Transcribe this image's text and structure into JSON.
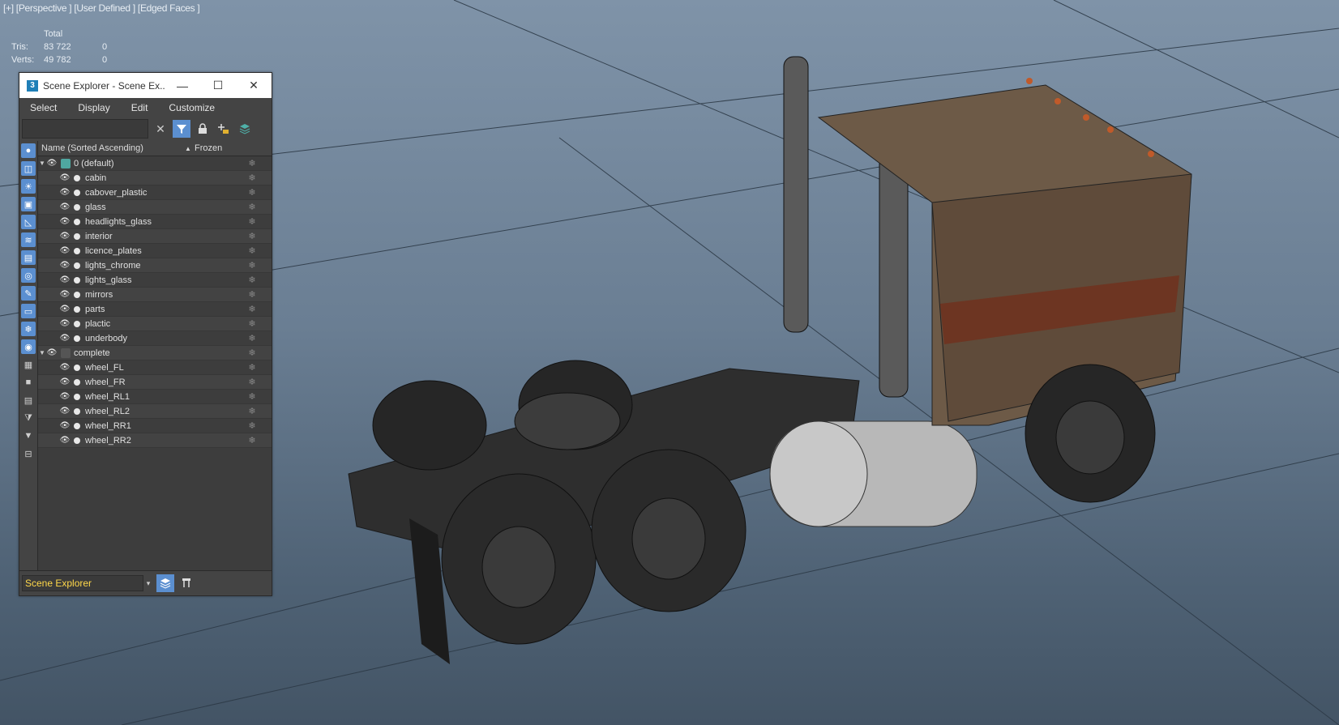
{
  "viewport": {
    "label": "[+] [Perspective ] [User Defined ] [Edged Faces ]",
    "stats": {
      "header": "Total",
      "rows": [
        {
          "label": "Tris:",
          "total": "83 722",
          "selected": "0"
        },
        {
          "label": "Verts:",
          "total": "49 782",
          "selected": "0"
        }
      ]
    }
  },
  "explorer": {
    "title": "Scene Explorer - Scene Ex...",
    "app_icon": "3",
    "window_buttons": {
      "minimize": "—",
      "maximize": "☐",
      "close": "✕"
    },
    "menu": [
      "Select",
      "Display",
      "Edit",
      "Customize"
    ],
    "search": {
      "value": ""
    },
    "toolbar": {
      "clear": "✕",
      "filter": "funnel-icon",
      "lock": "lock-icon",
      "add": "add-layer-icon",
      "layers": "layers-icon"
    },
    "columns": {
      "name": "Name (Sorted Ascending)",
      "sort": "▲",
      "frozen": "Frozen"
    },
    "layers": [
      {
        "name": "0 (default)",
        "items": [
          "cabin",
          "cabover_plastic",
          "glass",
          "headlights_glass",
          "interior",
          "licence_plates",
          "lights_chrome",
          "lights_glass",
          "mirrors",
          "parts",
          "plactic",
          "underbody"
        ]
      },
      {
        "name": "complete",
        "items": [
          "wheel_FL",
          "wheel_FR",
          "wheel_RL1",
          "wheel_RL2",
          "wheel_RR1",
          "wheel_RR2"
        ]
      }
    ],
    "footer": {
      "combo_value": "Scene Explorer"
    }
  },
  "colors": {
    "accent": "#5b8fd0",
    "footer_text": "#ffd84a",
    "viewport_top": "#7f93a8",
    "viewport_bottom": "#435465"
  }
}
